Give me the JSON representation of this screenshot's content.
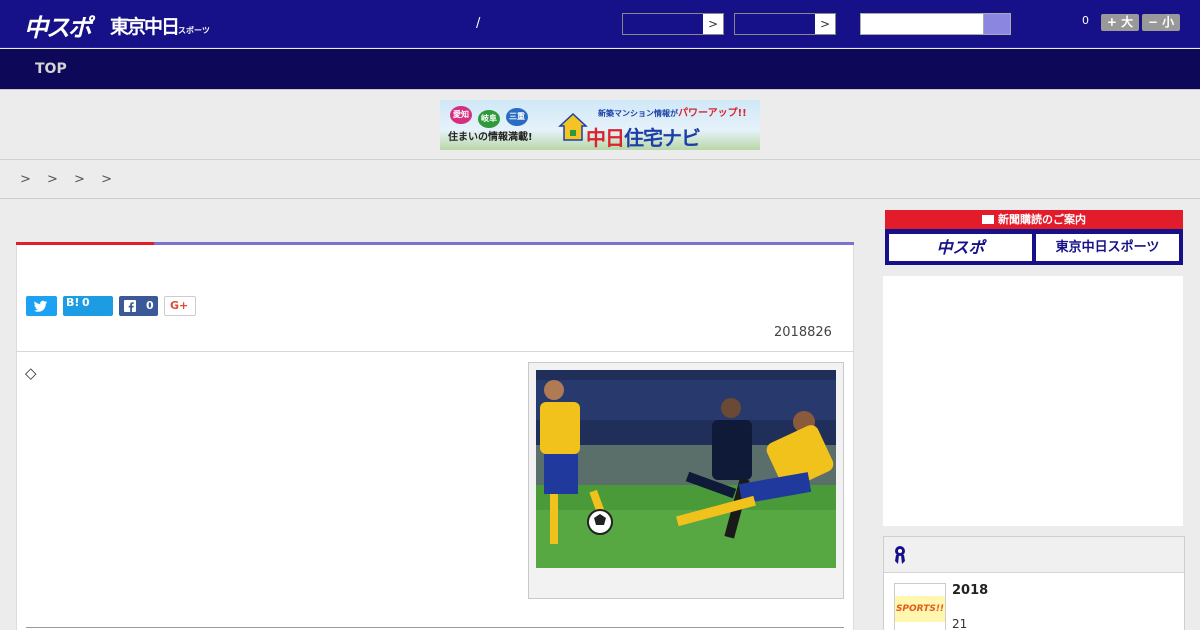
{
  "header": {
    "logo_chuspo": "中スポ",
    "logo_tokyo": "東京中日",
    "logo_tokyo_small": "スポーツ",
    "slash": "/",
    "select_arrow": ">",
    "font_count": "0",
    "font_larger": "+ 大",
    "font_smaller": "− 小",
    "colors": {
      "header_bg": "#161089",
      "nav_bg": "#0e0858",
      "accent_red": "#e21c2b",
      "accent_purple": "#7b74cf"
    }
  },
  "nav": {
    "top_label": "TOP"
  },
  "banner": {
    "pill_1": "愛知",
    "pill_2": "岐阜",
    "pill_3": "三重",
    "left_text": "住まいの情報満載!",
    "top_text": "新築マンション情報が",
    "top_emph": "パワーアップ!!",
    "title_red": "中日",
    "title_blue": "住宅ナビ"
  },
  "breadcrumb": {
    "text": "> > > >"
  },
  "article": {
    "share": {
      "hatena_label": "B!",
      "hatena_count": "0",
      "facebook_count": "0",
      "gplus_label": "G+"
    },
    "date": "2018826",
    "diamond": "◇",
    "photo_icon": "soccer-photo"
  },
  "sidebar": {
    "subscribe_header": "新聞購読のご案内",
    "subscribe_chuspo": "中スポ",
    "subscribe_tokyo": "東京中日スポーツ",
    "ranking_title": "2018",
    "ranking_sub": "21",
    "ranking_thumb_text": "SPORTS!!"
  }
}
